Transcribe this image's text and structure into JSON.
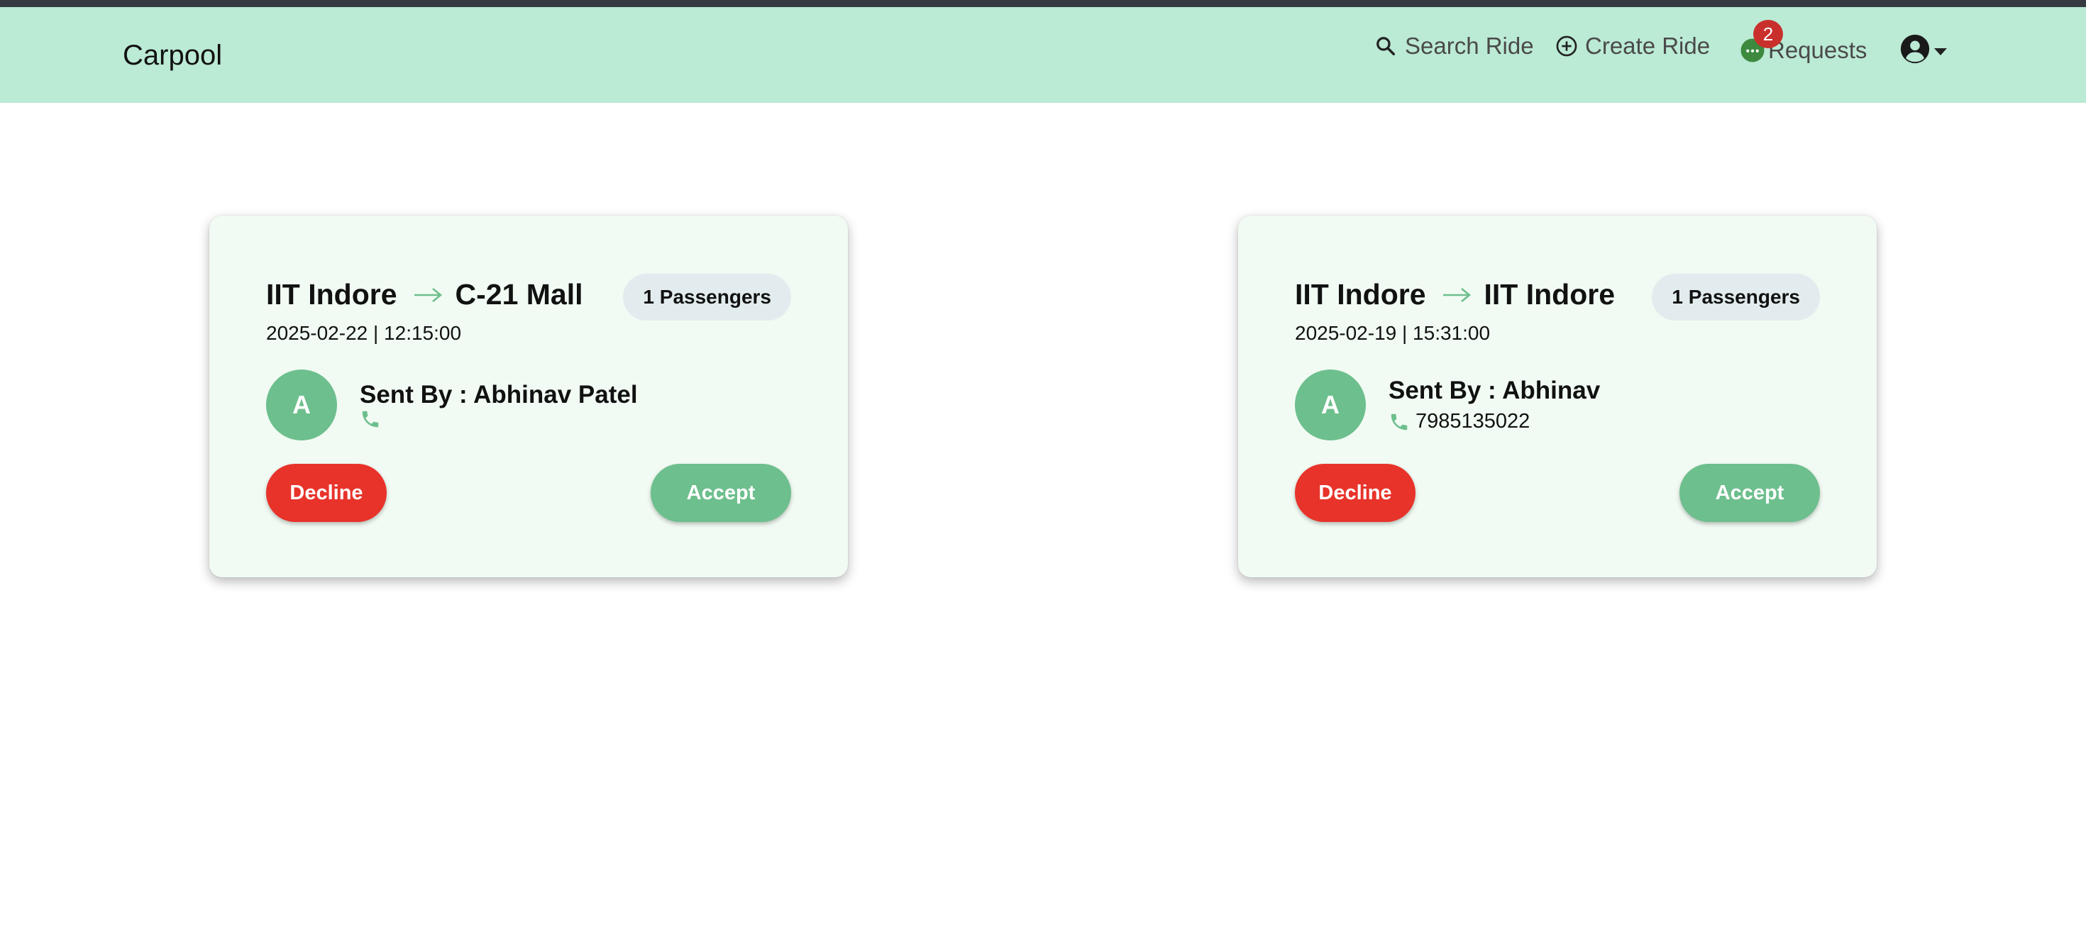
{
  "navbar": {
    "brand": "Carpool",
    "search_ride": "Search Ride",
    "create_ride": "Create Ride",
    "requests": "Requests",
    "requests_count": "2",
    "background_color": "#bbead5"
  },
  "requests": [
    {
      "from": "IIT Indore",
      "to": "C-21 Mall",
      "passengers": "1 Passengers",
      "datetime": "2025-02-22 | 12:15:00",
      "avatar_initial": "A",
      "sent_by": "Sent By : Abhinav Patel",
      "phone": "",
      "decline_label": "Decline",
      "accept_label": "Accept"
    },
    {
      "from": "IIT Indore",
      "to": "IIT Indore",
      "passengers": "1 Passengers",
      "datetime": "2025-02-19 | 15:31:00",
      "avatar_initial": "A",
      "sent_by": "Sent By : Abhinav",
      "phone": "7985135022",
      "decline_label": "Decline",
      "accept_label": "Accept"
    }
  ],
  "colors": {
    "accent_green": "#6dbf8d",
    "decline_red": "#e8332a",
    "card_background": "#f1fbf3",
    "badge_red": "#c9302c"
  },
  "icons": [
    "search-icon",
    "plus-circle-icon",
    "chat-icon",
    "user-circle-icon",
    "arrow-right-icon",
    "phone-icon"
  ]
}
